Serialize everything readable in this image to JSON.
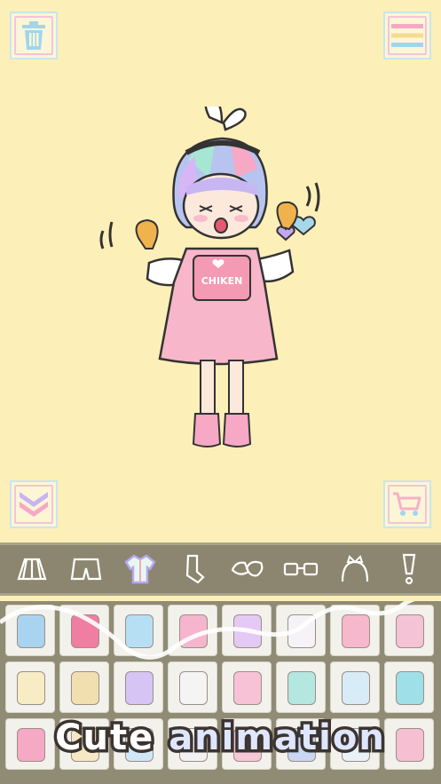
{
  "caption": {
    "word1": "Cute",
    "word2": "animation"
  },
  "colors": {
    "background": "#fcefb8",
    "toolbar": "#8c8670",
    "panel": "#908b75",
    "accent_pink": "#f4a6c0",
    "accent_blue": "#a6d8ea"
  },
  "corner_buttons": [
    {
      "name": "trash-icon"
    },
    {
      "name": "menu-icon"
    },
    {
      "name": "chevron-down-icon"
    },
    {
      "name": "cart-icon"
    }
  ],
  "character": {
    "shirt_text": "CHIKEN"
  },
  "categories": [
    {
      "icon": "skirt-icon"
    },
    {
      "icon": "shorts-icon"
    },
    {
      "icon": "top-icon",
      "selected": true
    },
    {
      "icon": "socks-icon"
    },
    {
      "icon": "shoes-icon"
    },
    {
      "icon": "glasses-icon"
    },
    {
      "icon": "headband-icon"
    },
    {
      "icon": "exclamation-icon"
    }
  ],
  "items": [
    {
      "color": "#a9d4ef"
    },
    {
      "color": "#f07ea2"
    },
    {
      "color": "#b7dff3"
    },
    {
      "color": "#f5b6cd"
    },
    {
      "color": "#e4c9f5"
    },
    {
      "color": "#f5f3f8"
    },
    {
      "color": "#f6b8cc"
    },
    {
      "color": "#f4c3d5"
    },
    {
      "color": "#f8ecc5"
    },
    {
      "color": "#f2dfb0"
    },
    {
      "color": "#d6c4f4"
    },
    {
      "color": "#f4f4f4"
    },
    {
      "color": "#f7c2d6"
    },
    {
      "color": "#b3e7e0"
    },
    {
      "color": "#d7ecf7"
    },
    {
      "color": "#9fe0e8"
    },
    {
      "color": "#f5a9c5"
    },
    {
      "color": "#f6e7c6"
    },
    {
      "color": "#cfe7f7"
    },
    {
      "color": "#f2f2f2"
    },
    {
      "color": "#f7c8d8"
    },
    {
      "color": "#c9d7f3"
    },
    {
      "color": "#e8f2f7"
    },
    {
      "color": "#f6bfd2"
    }
  ]
}
